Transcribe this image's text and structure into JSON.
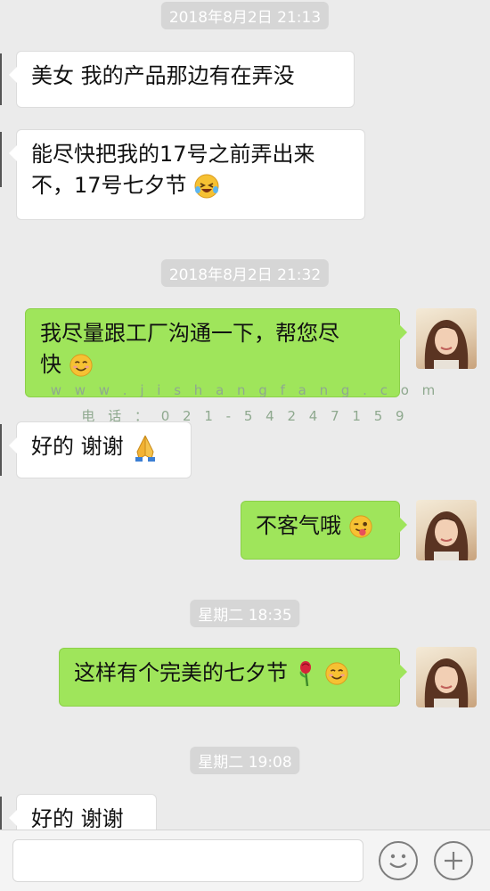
{
  "chat": {
    "ts1": "2018年8月2日 21:13",
    "msg1": "美女  我的产品那边有在弄没",
    "msg2_line1": "能尽快把我的17号之前弄出来",
    "msg2_line2": "不，17号七夕节",
    "ts2": "2018年8月2日 21:32",
    "msg3_line1": "我尽量跟工厂沟通一下，帮您尽",
    "msg3_line2": "快",
    "msg4": "好的  谢谢",
    "msg5": "不客气哦",
    "ts3": "星期二 18:35",
    "msg6": "这样有个完美的七夕节",
    "ts4": "星期二 19:08",
    "msg7": "好的  谢谢"
  },
  "watermark": {
    "url": "w w w . j i s h a n g f a n g . c o m",
    "phone": "电 话 ：  0 2 1 - 5 4 2 4 7 1 5 9"
  },
  "icons": {
    "emoji_laugh": "laughing-crying-emoji-icon",
    "emoji_smile": "smiling-emoji-icon",
    "emoji_pray": "praying-hands-emoji-icon",
    "emoji_wink": "winking-tongue-emoji-icon",
    "emoji_rose": "rose-emoji-icon",
    "emoji_button": "emoji-icon",
    "plus_button": "plus-icon"
  },
  "colors": {
    "sent_bubble": "#9fe55b",
    "received_bubble": "#ffffff",
    "background": "#ebebeb",
    "timestamp_bg": "#d6d6d6"
  }
}
